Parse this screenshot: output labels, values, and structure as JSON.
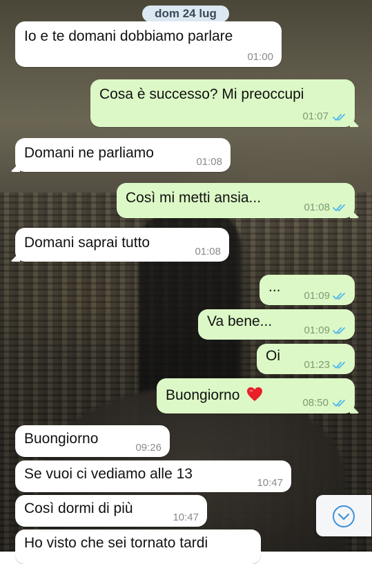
{
  "chat": {
    "date_separator": "dom 24 lug",
    "messages": [
      {
        "direction": "incoming",
        "text": "Io e te domani dobbiamo parlare",
        "time": "01:00"
      },
      {
        "direction": "outgoing",
        "text": "Cosa è successo? Mi preoccupi",
        "time": "01:07",
        "status": "read"
      },
      {
        "direction": "incoming",
        "text": "Domani ne parliamo",
        "time": "01:08"
      },
      {
        "direction": "outgoing",
        "text": "Così mi metti ansia...",
        "time": "01:08",
        "status": "read"
      },
      {
        "direction": "incoming",
        "text": "Domani saprai tutto",
        "time": "01:08"
      },
      {
        "direction": "outgoing",
        "text": "...",
        "time": "01:09",
        "status": "read"
      },
      {
        "direction": "outgoing",
        "text": "Va bene...",
        "time": "01:09",
        "status": "read"
      },
      {
        "direction": "outgoing",
        "text": "Oi",
        "time": "01:23",
        "status": "read"
      },
      {
        "direction": "outgoing",
        "text": "Buongiorno",
        "emoji": "❤️",
        "time": "08:50",
        "status": "read"
      },
      {
        "direction": "incoming",
        "text": "Buongiorno",
        "time": "09:26"
      },
      {
        "direction": "incoming",
        "text": "Se vuoi ci vediamo alle 13",
        "time": "10:47"
      },
      {
        "direction": "incoming",
        "text": "Così dormi di più",
        "time": "10:47"
      },
      {
        "direction": "incoming",
        "text": "Ho visto che sei tornato tardi",
        "time": ""
      }
    ]
  },
  "colors": {
    "incoming_bubble": "#ffffff",
    "outgoing_bubble": "#dcf8c6",
    "read_ticks": "#4fb6ec",
    "date_pill": "#dce8f2"
  },
  "icons": {
    "read_status": "double-check-icon",
    "scroll_down": "chevron-down-circle-icon",
    "heart": "red-heart-emoji"
  }
}
